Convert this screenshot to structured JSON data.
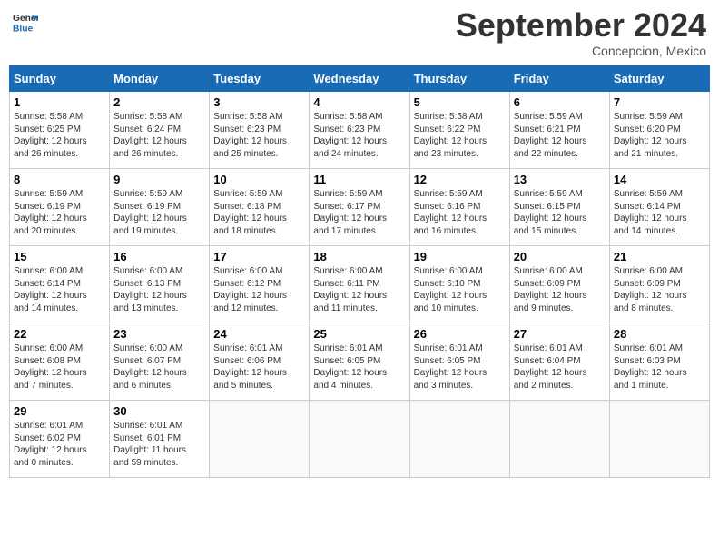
{
  "header": {
    "logo_line1": "General",
    "logo_line2": "Blue",
    "month": "September 2024",
    "location": "Concepcion, Mexico"
  },
  "days_of_week": [
    "Sunday",
    "Monday",
    "Tuesday",
    "Wednesday",
    "Thursday",
    "Friday",
    "Saturday"
  ],
  "weeks": [
    [
      {
        "day": "1",
        "info": "Sunrise: 5:58 AM\nSunset: 6:25 PM\nDaylight: 12 hours\nand 26 minutes."
      },
      {
        "day": "2",
        "info": "Sunrise: 5:58 AM\nSunset: 6:24 PM\nDaylight: 12 hours\nand 26 minutes."
      },
      {
        "day": "3",
        "info": "Sunrise: 5:58 AM\nSunset: 6:23 PM\nDaylight: 12 hours\nand 25 minutes."
      },
      {
        "day": "4",
        "info": "Sunrise: 5:58 AM\nSunset: 6:23 PM\nDaylight: 12 hours\nand 24 minutes."
      },
      {
        "day": "5",
        "info": "Sunrise: 5:58 AM\nSunset: 6:22 PM\nDaylight: 12 hours\nand 23 minutes."
      },
      {
        "day": "6",
        "info": "Sunrise: 5:59 AM\nSunset: 6:21 PM\nDaylight: 12 hours\nand 22 minutes."
      },
      {
        "day": "7",
        "info": "Sunrise: 5:59 AM\nSunset: 6:20 PM\nDaylight: 12 hours\nand 21 minutes."
      }
    ],
    [
      {
        "day": "8",
        "info": "Sunrise: 5:59 AM\nSunset: 6:19 PM\nDaylight: 12 hours\nand 20 minutes."
      },
      {
        "day": "9",
        "info": "Sunrise: 5:59 AM\nSunset: 6:19 PM\nDaylight: 12 hours\nand 19 minutes."
      },
      {
        "day": "10",
        "info": "Sunrise: 5:59 AM\nSunset: 6:18 PM\nDaylight: 12 hours\nand 18 minutes."
      },
      {
        "day": "11",
        "info": "Sunrise: 5:59 AM\nSunset: 6:17 PM\nDaylight: 12 hours\nand 17 minutes."
      },
      {
        "day": "12",
        "info": "Sunrise: 5:59 AM\nSunset: 6:16 PM\nDaylight: 12 hours\nand 16 minutes."
      },
      {
        "day": "13",
        "info": "Sunrise: 5:59 AM\nSunset: 6:15 PM\nDaylight: 12 hours\nand 15 minutes."
      },
      {
        "day": "14",
        "info": "Sunrise: 5:59 AM\nSunset: 6:14 PM\nDaylight: 12 hours\nand 14 minutes."
      }
    ],
    [
      {
        "day": "15",
        "info": "Sunrise: 6:00 AM\nSunset: 6:14 PM\nDaylight: 12 hours\nand 14 minutes."
      },
      {
        "day": "16",
        "info": "Sunrise: 6:00 AM\nSunset: 6:13 PM\nDaylight: 12 hours\nand 13 minutes."
      },
      {
        "day": "17",
        "info": "Sunrise: 6:00 AM\nSunset: 6:12 PM\nDaylight: 12 hours\nand 12 minutes."
      },
      {
        "day": "18",
        "info": "Sunrise: 6:00 AM\nSunset: 6:11 PM\nDaylight: 12 hours\nand 11 minutes."
      },
      {
        "day": "19",
        "info": "Sunrise: 6:00 AM\nSunset: 6:10 PM\nDaylight: 12 hours\nand 10 minutes."
      },
      {
        "day": "20",
        "info": "Sunrise: 6:00 AM\nSunset: 6:09 PM\nDaylight: 12 hours\nand 9 minutes."
      },
      {
        "day": "21",
        "info": "Sunrise: 6:00 AM\nSunset: 6:09 PM\nDaylight: 12 hours\nand 8 minutes."
      }
    ],
    [
      {
        "day": "22",
        "info": "Sunrise: 6:00 AM\nSunset: 6:08 PM\nDaylight: 12 hours\nand 7 minutes."
      },
      {
        "day": "23",
        "info": "Sunrise: 6:00 AM\nSunset: 6:07 PM\nDaylight: 12 hours\nand 6 minutes."
      },
      {
        "day": "24",
        "info": "Sunrise: 6:01 AM\nSunset: 6:06 PM\nDaylight: 12 hours\nand 5 minutes."
      },
      {
        "day": "25",
        "info": "Sunrise: 6:01 AM\nSunset: 6:05 PM\nDaylight: 12 hours\nand 4 minutes."
      },
      {
        "day": "26",
        "info": "Sunrise: 6:01 AM\nSunset: 6:05 PM\nDaylight: 12 hours\nand 3 minutes."
      },
      {
        "day": "27",
        "info": "Sunrise: 6:01 AM\nSunset: 6:04 PM\nDaylight: 12 hours\nand 2 minutes."
      },
      {
        "day": "28",
        "info": "Sunrise: 6:01 AM\nSunset: 6:03 PM\nDaylight: 12 hours\nand 1 minute."
      }
    ],
    [
      {
        "day": "29",
        "info": "Sunrise: 6:01 AM\nSunset: 6:02 PM\nDaylight: 12 hours\nand 0 minutes."
      },
      {
        "day": "30",
        "info": "Sunrise: 6:01 AM\nSunset: 6:01 PM\nDaylight: 11 hours\nand 59 minutes."
      },
      {
        "day": "",
        "info": ""
      },
      {
        "day": "",
        "info": ""
      },
      {
        "day": "",
        "info": ""
      },
      {
        "day": "",
        "info": ""
      },
      {
        "day": "",
        "info": ""
      }
    ]
  ]
}
